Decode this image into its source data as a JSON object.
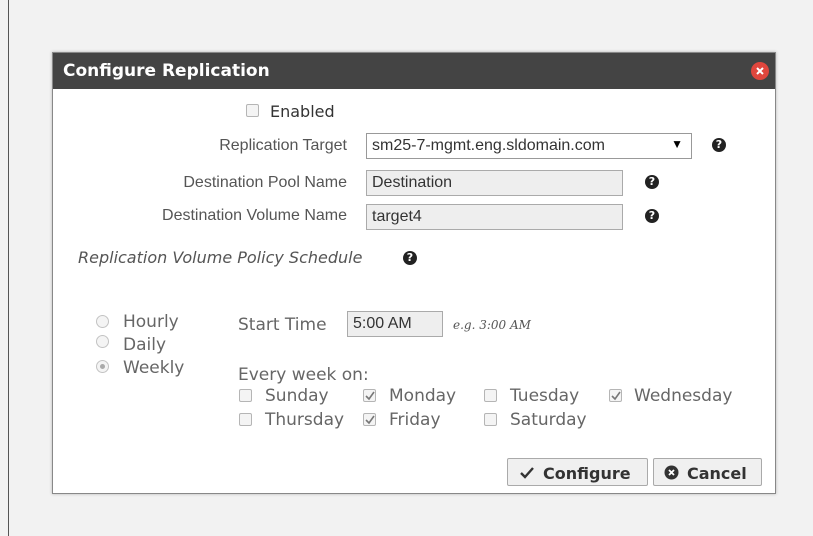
{
  "dialog": {
    "title": "Configure Replication",
    "enabled_label": "Enabled",
    "enabled_checked": false,
    "replication_target": {
      "label": "Replication Target",
      "value": "sm25-7-mgmt.eng.sldomain.com"
    },
    "destination_pool": {
      "label": "Destination Pool Name",
      "value": "Destination"
    },
    "destination_volume": {
      "label": "Destination Volume Name",
      "value": "target4"
    },
    "schedule_title": "Replication Volume Policy Schedule",
    "frequency": {
      "options": [
        "Hourly",
        "Daily",
        "Weekly"
      ],
      "selected": "Weekly"
    },
    "start_time": {
      "label": "Start Time",
      "value": "5:00 AM",
      "hint": "e.g. 3:00 AM"
    },
    "every_week_label": "Every week on:",
    "days": {
      "sunday": {
        "label": "Sunday",
        "checked": false
      },
      "monday": {
        "label": "Monday",
        "checked": true
      },
      "tuesday": {
        "label": "Tuesday",
        "checked": false
      },
      "wednesday": {
        "label": "Wednesday",
        "checked": true
      },
      "thursday": {
        "label": "Thursday",
        "checked": false
      },
      "friday": {
        "label": "Friday",
        "checked": true
      },
      "saturday": {
        "label": "Saturday",
        "checked": false
      }
    },
    "buttons": {
      "configure": "Configure",
      "cancel": "Cancel"
    },
    "icons": {
      "help": "question-circle-icon",
      "close": "close-circle-icon",
      "check": "checkmark-icon",
      "cancel": "x-circle-icon"
    },
    "colors": {
      "titlebar": "#444444",
      "close": "#e0463d"
    }
  }
}
